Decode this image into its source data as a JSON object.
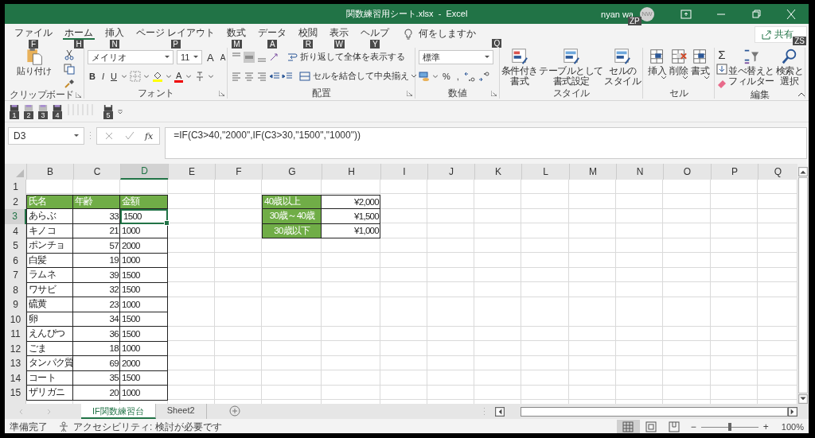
{
  "window": {
    "title": "関数練習用シート.xlsx  -  Excel",
    "user": "nyan wa",
    "user_keytip": "ZP",
    "avatar": "NW"
  },
  "tabs": [
    {
      "label": "ファイル",
      "keytip": "F",
      "selected": false
    },
    {
      "label": "ホーム",
      "keytip": "H",
      "selected": true
    },
    {
      "label": "挿入",
      "keytip": "N",
      "selected": false
    },
    {
      "label": "ページ レイアウト",
      "keytip": "P",
      "selected": false
    },
    {
      "label": "数式",
      "keytip": "M",
      "selected": false
    },
    {
      "label": "データ",
      "keytip": "A",
      "selected": false
    },
    {
      "label": "校閲",
      "keytip": "R",
      "selected": false
    },
    {
      "label": "表示",
      "keytip": "W",
      "selected": false
    },
    {
      "label": "ヘルプ",
      "keytip": "Y",
      "selected": false
    }
  ],
  "tell_me": {
    "label": "何をしますか",
    "keytip": "Q"
  },
  "share": {
    "label": "共有",
    "keytip": "ZS"
  },
  "ribbon": {
    "clipboard": {
      "paste": "貼り付け",
      "group": "クリップボード"
    },
    "font": {
      "name": "メイリオ",
      "size": "11",
      "grow": "A",
      "shrink": "A",
      "styles": [
        "B",
        "I",
        "U"
      ],
      "color_letter": "A",
      "group": "フォント"
    },
    "alignment": {
      "wrap": "折り返して全体を表示する",
      "merge": "セルを結合して中央揃え",
      "group": "配置"
    },
    "number": {
      "format": "標準",
      "percent": "%",
      "comma": ",",
      "group": "数値"
    },
    "styles": {
      "buttons": [
        {
          "lines": [
            "条件付き",
            "書式"
          ]
        },
        {
          "lines": [
            "テーブルとして",
            "書式設定"
          ]
        },
        {
          "lines": [
            "セルの",
            "スタイル"
          ]
        }
      ],
      "group": "スタイル"
    },
    "cells": {
      "buttons": [
        "挿入",
        "削除",
        "書式"
      ],
      "group": "セル"
    },
    "editing": {
      "sum": "Σ",
      "buttons": [
        {
          "lines": [
            "並べ替えと",
            "フィルター"
          ]
        },
        {
          "lines": [
            "検索と",
            "選択"
          ]
        }
      ],
      "group": "編集"
    }
  },
  "quick_access": {
    "keytips": [
      "1",
      "2",
      "3",
      "4",
      "5"
    ]
  },
  "formula_bar": {
    "name_box": "D3",
    "fx": "fx",
    "formula": "=IF(C3>40,\"2000\",IF(C3>30,\"1500\",\"1000\"))"
  },
  "sheet": {
    "columns": [
      {
        "label": "B",
        "selected": false
      },
      {
        "label": "C",
        "selected": false
      },
      {
        "label": "D",
        "selected": true
      },
      {
        "label": "E",
        "selected": false
      },
      {
        "label": "F",
        "selected": false
      },
      {
        "label": "G",
        "selected": false
      },
      {
        "label": "H",
        "selected": false
      },
      {
        "label": "I",
        "selected": false
      },
      {
        "label": "J",
        "selected": false
      },
      {
        "label": "K",
        "selected": false
      },
      {
        "label": "L",
        "selected": false
      },
      {
        "label": "M",
        "selected": false
      },
      {
        "label": "N",
        "selected": false
      },
      {
        "label": "O",
        "selected": false
      },
      {
        "label": "P",
        "selected": false
      },
      {
        "label": "Q",
        "selected": false
      }
    ],
    "rows": [
      {
        "number": "1",
        "selected": false
      },
      {
        "number": "2",
        "selected": false
      },
      {
        "number": "3",
        "selected": true
      },
      {
        "number": "4",
        "selected": false
      },
      {
        "number": "5",
        "selected": false
      },
      {
        "number": "6",
        "selected": false
      },
      {
        "number": "7",
        "selected": false
      },
      {
        "number": "8",
        "selected": false
      },
      {
        "number": "9",
        "selected": false
      },
      {
        "number": "10",
        "selected": false
      },
      {
        "number": "11",
        "selected": false
      },
      {
        "number": "12",
        "selected": false
      },
      {
        "number": "13",
        "selected": false
      },
      {
        "number": "14",
        "selected": false
      },
      {
        "number": "15",
        "selected": false
      }
    ],
    "name_table": {
      "header": [
        "氏名",
        "年齢",
        "金額"
      ],
      "records": [
        {
          "name": "あらぶ",
          "age": "33",
          "amount": "1500",
          "selected": true
        },
        {
          "name": "キノコ",
          "age": "21",
          "amount": "1000",
          "selected": false
        },
        {
          "name": "ポンチョ",
          "age": "57",
          "amount": "2000",
          "selected": false
        },
        {
          "name": "白髪",
          "age": "19",
          "amount": "1000",
          "selected": false
        },
        {
          "name": "ラムネ",
          "age": "39",
          "amount": "1500",
          "selected": false
        },
        {
          "name": "ワサビ",
          "age": "32",
          "amount": "1500",
          "selected": false
        },
        {
          "name": "硫黄",
          "age": "23",
          "amount": "1000",
          "selected": false
        },
        {
          "name": "卵",
          "age": "34",
          "amount": "1500",
          "selected": false
        },
        {
          "name": "えんぴつ",
          "age": "36",
          "amount": "1500",
          "selected": false
        },
        {
          "name": "ごま",
          "age": "18",
          "amount": "1000",
          "selected": false
        },
        {
          "name": "タンパク質",
          "age": "69",
          "amount": "2000",
          "selected": false
        },
        {
          "name": "コート",
          "age": "35",
          "amount": "1500",
          "selected": false
        },
        {
          "name": "ザリガニ",
          "age": "20",
          "amount": "1000",
          "selected": false
        }
      ]
    },
    "price_table": [
      {
        "label": "40歳以上",
        "kind": "heading",
        "price": "¥2,000"
      },
      {
        "label": "30歳～40歳",
        "kind": "label",
        "price": "¥1,500"
      },
      {
        "label": "30歳以下",
        "kind": "label",
        "price": "¥1,000"
      }
    ]
  },
  "sheet_tabs": [
    {
      "label": "IF関数練習台",
      "selected": true
    },
    {
      "label": "Sheet2",
      "selected": false
    }
  ],
  "status_bar": {
    "status": "準備完了",
    "accessibility": "アクセシビリティ: 検討が必要です",
    "views": [
      {
        "kind": "normal",
        "selected": true
      },
      {
        "kind": "page-layout",
        "selected": false
      },
      {
        "kind": "page-break",
        "selected": false
      }
    ],
    "zoom": {
      "minus": "−",
      "plus": "+",
      "level": 0.5,
      "reading": "100%"
    }
  }
}
